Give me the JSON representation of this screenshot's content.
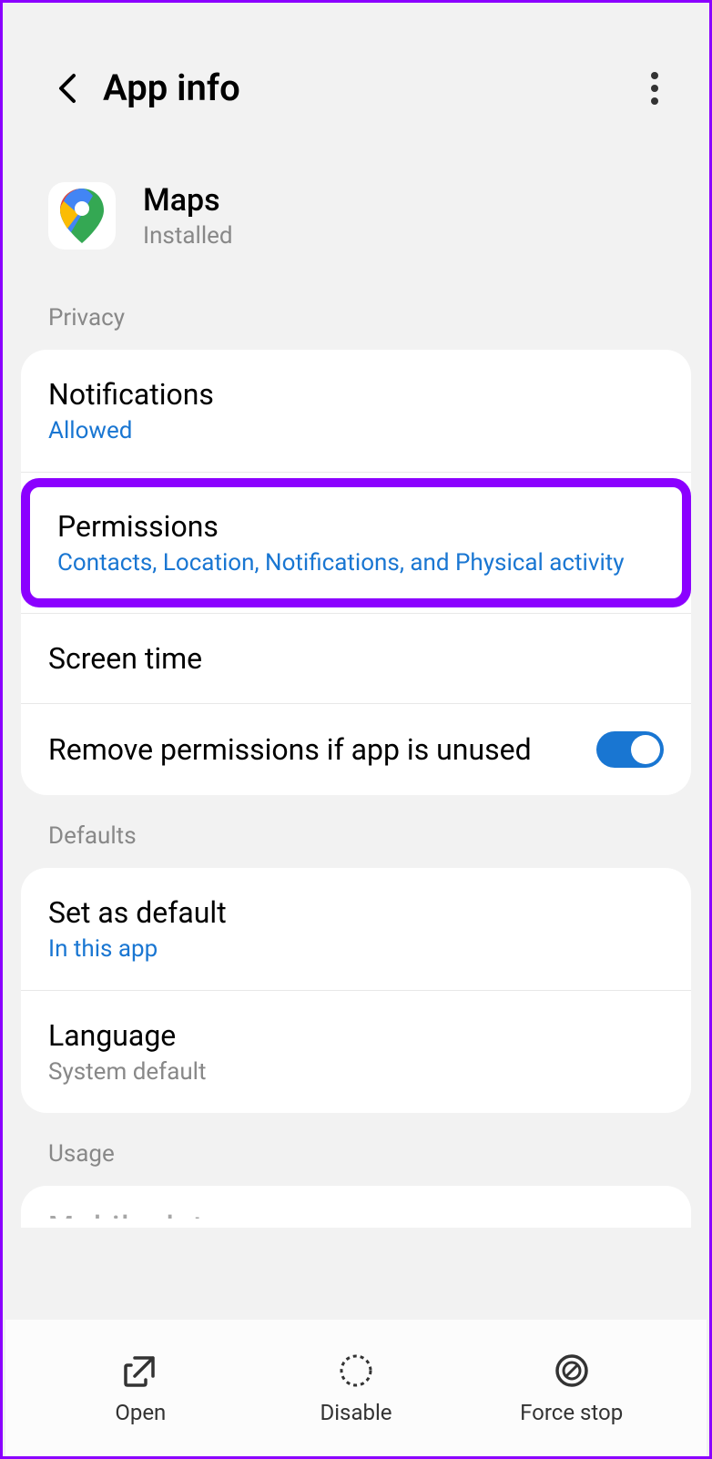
{
  "header": {
    "title": "App info"
  },
  "app": {
    "name": "Maps",
    "status": "Installed"
  },
  "sections": {
    "privacy": {
      "header": "Privacy",
      "notifications": {
        "title": "Notifications",
        "sub": "Allowed"
      },
      "permissions": {
        "title": "Permissions",
        "sub": "Contacts, Location, Notifications, and Physical activity"
      },
      "screen_time": {
        "title": "Screen time"
      },
      "remove_unused": {
        "title": "Remove permissions if app is unused",
        "toggle": true
      }
    },
    "defaults": {
      "header": "Defaults",
      "set_default": {
        "title": "Set as default",
        "sub": "In this app"
      },
      "language": {
        "title": "Language",
        "sub": "System default"
      }
    },
    "usage": {
      "header": "Usage",
      "mobile_data": {
        "title": "Mobile data"
      }
    }
  },
  "bottom": {
    "open": "Open",
    "disable": "Disable",
    "force_stop": "Force stop"
  }
}
